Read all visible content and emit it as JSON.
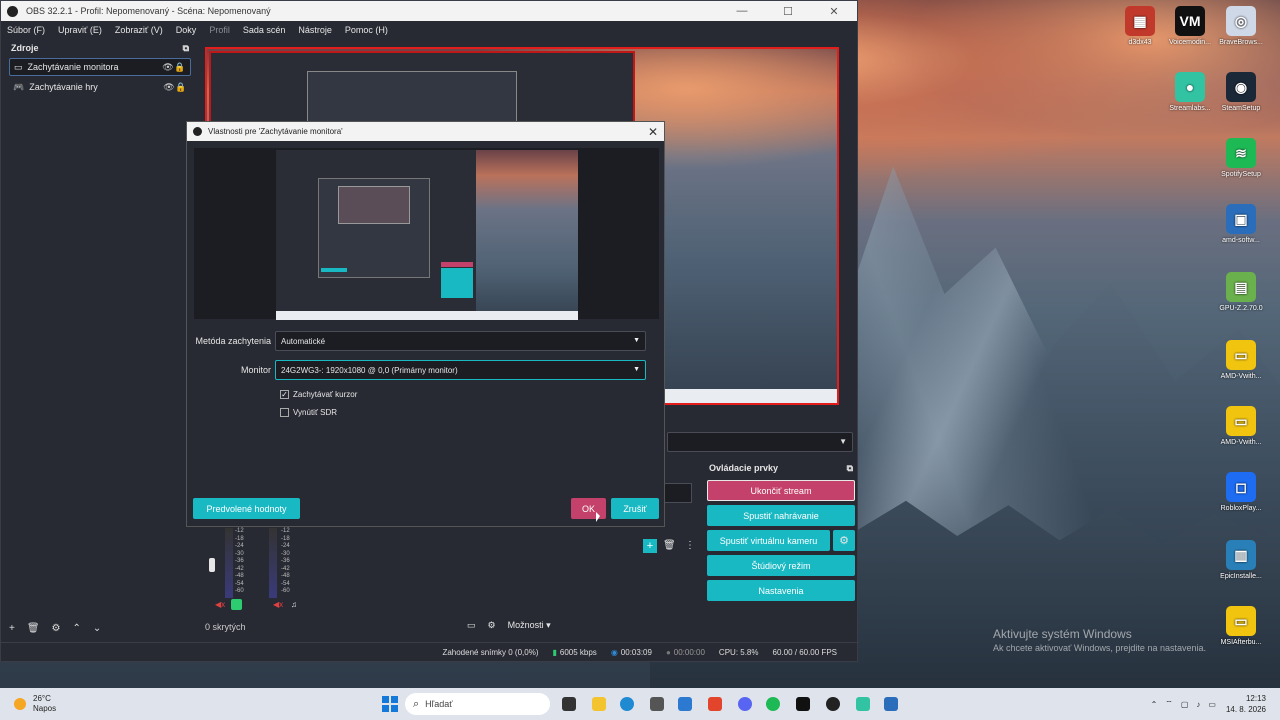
{
  "obs": {
    "title": "OBS 32.2.1 - Profil: Nepomenovaný - Scéna: Nepomenovaný",
    "window_buttons": [
      "—",
      "☐",
      "✕"
    ],
    "menu": [
      {
        "label": "Súbor (F)",
        "dim": false
      },
      {
        "label": "Upraviť (E)",
        "dim": false
      },
      {
        "label": "Zobraziť (V)",
        "dim": false
      },
      {
        "label": "Doky",
        "dim": false
      },
      {
        "label": "Profil",
        "dim": true
      },
      {
        "label": "Sada scén",
        "dim": false
      },
      {
        "label": "Nástroje",
        "dim": false
      },
      {
        "label": "Pomoc (H)",
        "dim": false
      }
    ],
    "sources_title": "Zdroje",
    "sources": [
      {
        "label": "Zachytávanie monitora",
        "selected": true
      },
      {
        "label": "Zachytávanie hry",
        "selected": false
      }
    ],
    "controls_title": "Ovládacie prvky",
    "controls": {
      "stop_stream": "Ukončiť stream",
      "start_recording": "Spustiť nahrávanie",
      "start_virtualcam": "Spustiť virtuálnu kameru",
      "studio_mode": "Štúdiový režim",
      "settings": "Nastavenia"
    },
    "meter_scale": [
      "-12",
      "-18",
      "-24",
      "-30",
      "-36",
      "-42",
      "-48",
      "-54",
      "-60"
    ],
    "hidden_count": "0 skrytých",
    "options_label": "Možnosti",
    "status": {
      "dropped": "Zahodené snímky 0 (0,0%)",
      "bitrate": "6005 kbps",
      "stream_time": "00:03:09",
      "rec_time": "00:00:00",
      "cpu": "CPU: 5.8%",
      "fps": "60.00 / 60.00 FPS"
    }
  },
  "dialog": {
    "title": "Vlastnosti pre 'Zachytávanie monitora'",
    "capture_method_label": "Metóda zachytenia",
    "capture_method_value": "Automatické",
    "monitor_label": "Monitor",
    "monitor_value": "24G2WG3-: 1920x1080 @ 0,0 (Primárny monitor)",
    "capture_cursor_label": "Zachytávať kurzor",
    "capture_cursor_checked": true,
    "force_sdr_label": "Vynútiť SDR",
    "force_sdr_checked": false,
    "defaults_button": "Predvolené hodnoty",
    "ok_button": "OK",
    "cancel_button": "Zrušiť"
  },
  "desktop_icons": [
    {
      "label": "d3dx43",
      "color": "#c0392b",
      "glyph": "▦"
    },
    {
      "label": "Voicemodin...",
      "color": "#111111",
      "glyph": "VM"
    },
    {
      "label": "BraveBrows...",
      "color": "#cfd8e6",
      "glyph": "◎"
    },
    {
      "label": "Streamlabs...",
      "color": "#31c3a2",
      "glyph": "●"
    },
    {
      "label": "SteamSetup",
      "color": "#1b2838",
      "glyph": "◉"
    },
    {
      "label": "SpotifySetup",
      "color": "#1db954",
      "glyph": "≋"
    },
    {
      "label": "amd-softw...",
      "color": "#2a6ebb",
      "glyph": "▣"
    },
    {
      "label": "GPU-Z.2.70.0",
      "color": "#6ab04c",
      "glyph": "▤"
    },
    {
      "label": "AMD-Vwith...",
      "color": "#f1c40f",
      "glyph": "▭"
    },
    {
      "label": "AMD-Vwith...",
      "color": "#f1c40f",
      "glyph": "▭"
    },
    {
      "label": "RobloxPlay...",
      "color": "#1d6cf2",
      "glyph": "◻"
    },
    {
      "label": "EpicInstalle...",
      "color": "#2980b9",
      "glyph": "▥"
    },
    {
      "label": "MSIAfterbu...",
      "color": "#f1c40f",
      "glyph": "▭"
    }
  ],
  "watermark": {
    "line1": "Aktivujte systém Windows",
    "line2": "Ak chcete aktivovať Windows, prejdite na nastavenia."
  },
  "taskbar": {
    "weather_temp": "26°C",
    "weather_desc": "Napos",
    "search_placeholder": "Hľadať",
    "time": "12:13",
    "date": "14. 8. 2026"
  }
}
